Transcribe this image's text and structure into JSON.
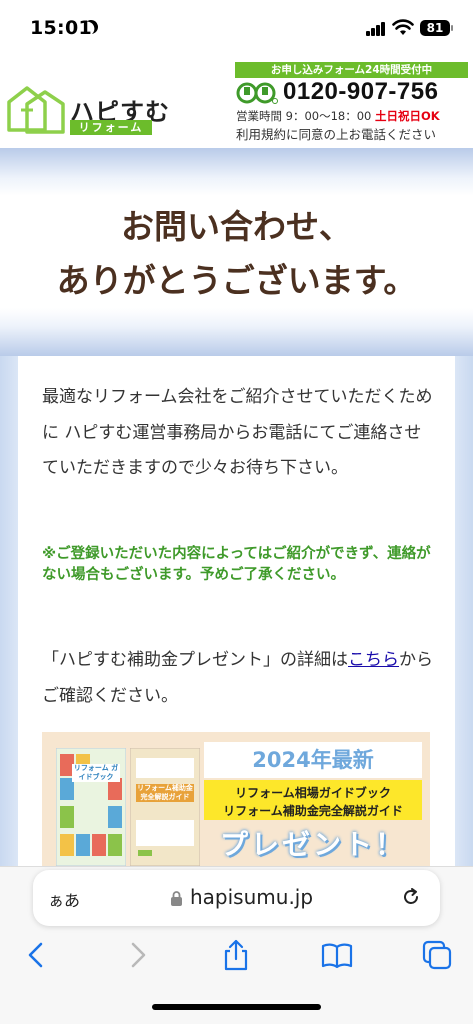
{
  "status": {
    "time": "15:01",
    "battery": "81"
  },
  "header": {
    "logo_name": "ハピすむ",
    "logo_sub": "リフォーム",
    "contact_banner": "お申し込みフォーム24時間受付中",
    "phone": "0120-907-756",
    "hours": "営業時間 9：00〜18：00",
    "hours_weekend": "土日祝日OK",
    "terms": "利用規約に同意の上お電話ください"
  },
  "hero": {
    "line1": "お問い合わせ、",
    "line2": "ありがとうございます。"
  },
  "content": {
    "para1": "最適なリフォーム会社をご紹介させていただくために ハピすむ運営事務局からお電話にてご連絡させていただきますので少々お待ち下さい。",
    "notice": "※ご登録いただいた内容によってはご紹介ができず、連絡がない場合もございます。予めご了承ください。",
    "para2_before": "「ハピすむ補助金プレゼント」の詳細は",
    "para2_link": "こちら",
    "para2_after": "からご確認ください。"
  },
  "promo": {
    "book1_title": "リフォーム ガイドブック",
    "book2_title": "リフォーム補助金 完全解説ガイド",
    "year_label": "2024年最新",
    "line1": "リフォーム相場ガイドブック",
    "line2": "リフォーム補助金完全解説ガイド",
    "present": "プレゼント！"
  },
  "safari": {
    "aa_label": "ぁあ",
    "url": "hapisumu.jp"
  },
  "colors": {
    "brand_green": "#6cbc2b",
    "title_brown": "#4b3020",
    "notice_green": "#3f9a2a",
    "link_blue": "#1a0dab"
  },
  "icons": [
    "moon-icon",
    "signal-icon",
    "wifi-icon",
    "battery-icon",
    "freedial-icon",
    "lock-icon",
    "reload-icon",
    "back-icon",
    "forward-icon",
    "share-icon",
    "bookmarks-icon",
    "tabs-icon"
  ]
}
